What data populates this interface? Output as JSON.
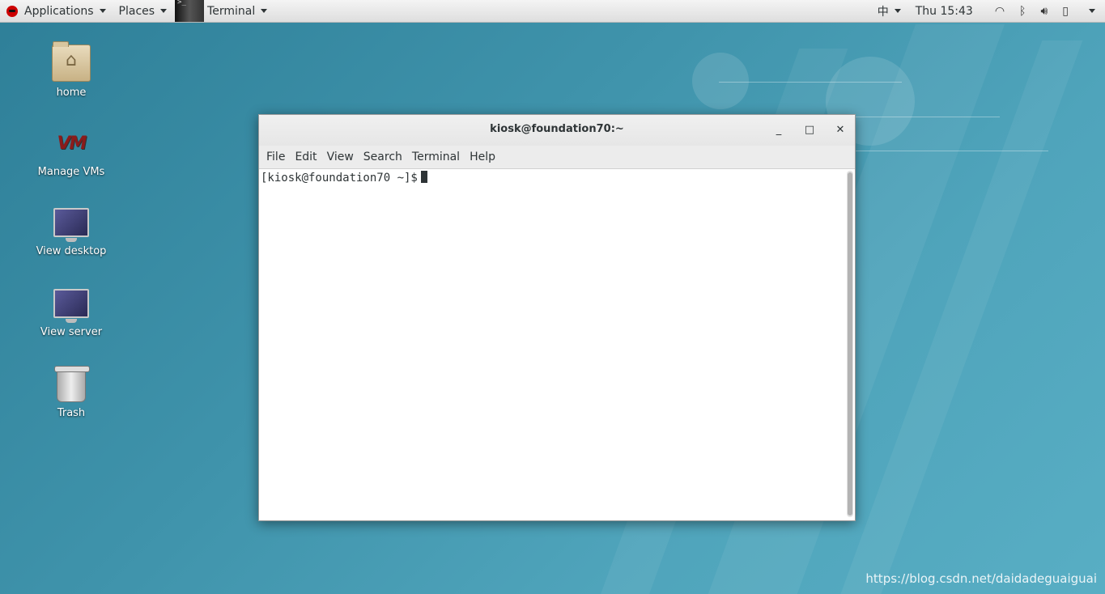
{
  "top_panel": {
    "applications_label": "Applications",
    "places_label": "Places",
    "terminal_label": "Terminal",
    "input_method": "中",
    "clock": "Thu 15:43"
  },
  "desktop_icons": [
    {
      "label": "home",
      "icon": "home-folder-icon"
    },
    {
      "label": "Manage VMs",
      "icon": "vm-manager-icon"
    },
    {
      "label": "View desktop",
      "icon": "monitor-icon"
    },
    {
      "label": "View server",
      "icon": "monitor-icon"
    },
    {
      "label": "Trash",
      "icon": "trash-icon"
    }
  ],
  "terminal": {
    "title": "kiosk@foundation70:~",
    "menu": [
      "File",
      "Edit",
      "View",
      "Search",
      "Terminal",
      "Help"
    ],
    "prompt": "[kiosk@foundation70 ~]$"
  },
  "watermark": "https://blog.csdn.net/daidadeguaiguai",
  "colors": {
    "desktop_bg": "#3f93ab",
    "panel_bg": "#e8e8e8",
    "terminal_bg": "#ffffff",
    "terminal_text": "#2e3436"
  }
}
